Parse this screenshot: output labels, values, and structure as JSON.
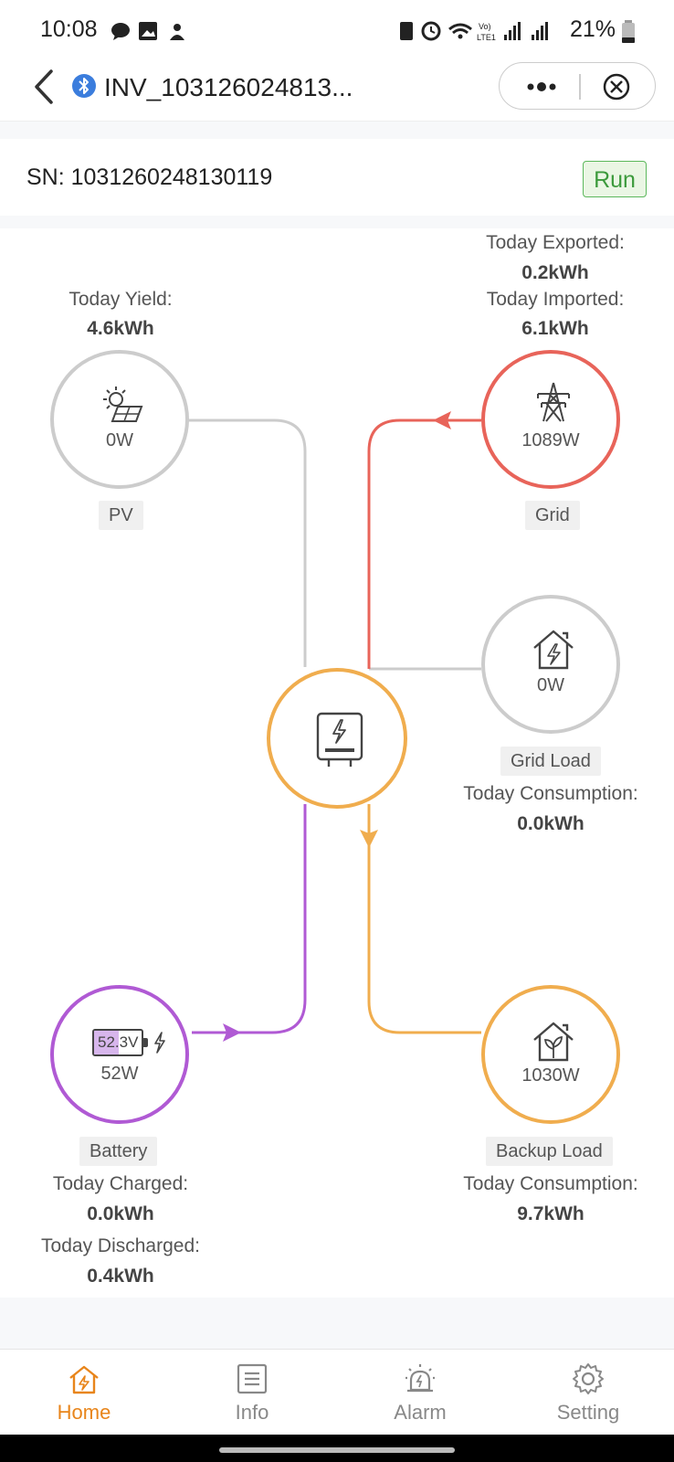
{
  "status_bar": {
    "time": "10:08",
    "battery": "21%"
  },
  "header": {
    "title": "INV_103126024813...",
    "more_label": "•••"
  },
  "device": {
    "sn": "SN: 1031260248130119",
    "status": "Run"
  },
  "colors": {
    "pv": "#cccccc",
    "grid": "#e8645a",
    "inverter": "#f0ad4e",
    "battery": "#b05ad4",
    "backup": "#f0ad4e",
    "accent": "#e8851b",
    "run": "#3c9a3c"
  },
  "pv": {
    "value": "0W",
    "name": "PV",
    "stat_label": "Today Yield:",
    "stat_value": "4.6kWh",
    "icon": "solar-panel-icon"
  },
  "grid": {
    "value": "1089W",
    "name": "Grid",
    "exported_label": "Today Exported:",
    "exported_value": "0.2kWh",
    "imported_label": "Today Imported:",
    "imported_value": "6.1kWh",
    "icon": "power-tower-icon"
  },
  "grid_load": {
    "value": "0W",
    "name": "Grid Load",
    "stat_label": "Today Consumption:",
    "stat_value": "0.0kWh",
    "icon": "house-bolt-icon"
  },
  "inverter": {
    "icon": "inverter-icon"
  },
  "battery": {
    "soc": "52.3V",
    "value": "52W",
    "name": "Battery",
    "charged_label": "Today Charged:",
    "charged_value": "0.0kWh",
    "discharged_label": "Today Discharged:",
    "discharged_value": "0.4kWh",
    "icon": "battery-icon"
  },
  "backup_load": {
    "value": "1030W",
    "name": "Backup Load",
    "stat_label": "Today Consumption:",
    "stat_value": "9.7kWh",
    "icon": "house-leaf-icon"
  },
  "nav": [
    {
      "label": "Home",
      "icon": "home-icon",
      "active": true
    },
    {
      "label": "Info",
      "icon": "document-icon"
    },
    {
      "label": "Alarm",
      "icon": "alarm-icon"
    },
    {
      "label": "Setting",
      "icon": "gear-icon"
    }
  ]
}
